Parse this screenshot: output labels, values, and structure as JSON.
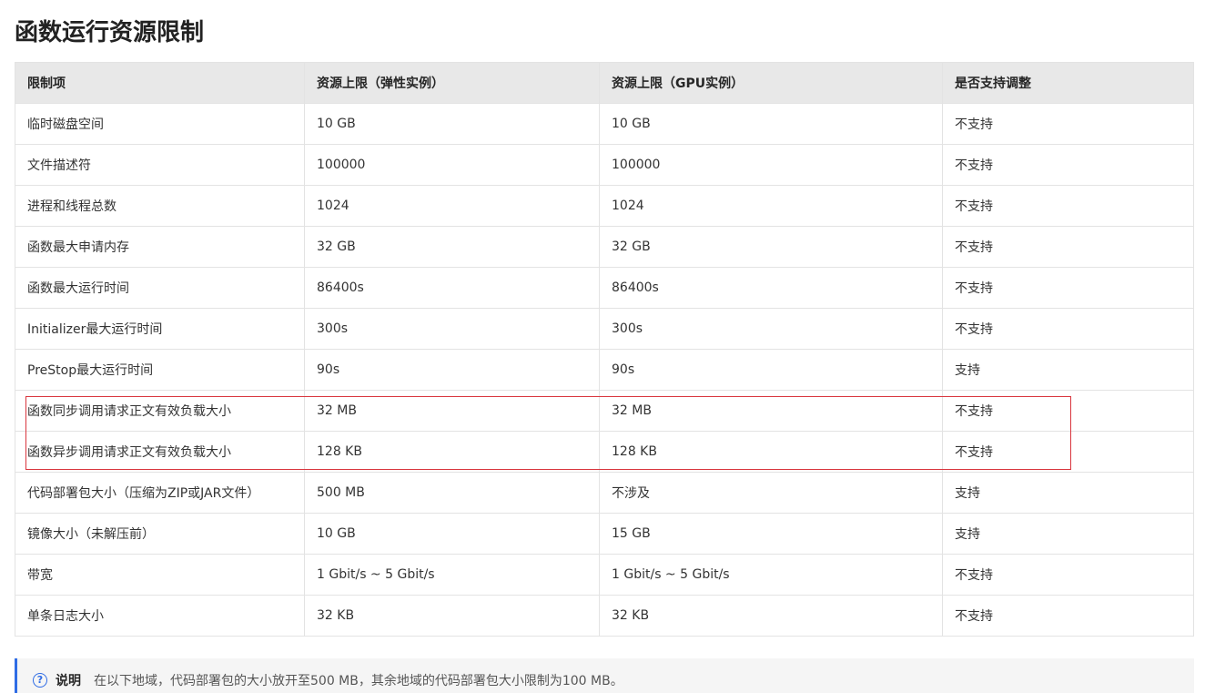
{
  "page_title": "函数运行资源限制",
  "table": {
    "headers": [
      "限制项",
      "资源上限（弹性实例）",
      "资源上限（GPU实例）",
      "是否支持调整"
    ],
    "rows": [
      [
        "临时磁盘空间",
        "10 GB",
        "10 GB",
        "不支持"
      ],
      [
        "文件描述符",
        "100000",
        "100000",
        "不支持"
      ],
      [
        "进程和线程总数",
        "1024",
        "1024",
        "不支持"
      ],
      [
        "函数最大申请内存",
        "32 GB",
        "32 GB",
        "不支持"
      ],
      [
        "函数最大运行时间",
        "86400s",
        "86400s",
        "不支持"
      ],
      [
        "Initializer最大运行时间",
        "300s",
        "300s",
        "不支持"
      ],
      [
        "PreStop最大运行时间",
        "90s",
        "90s",
        "支持"
      ],
      [
        "函数同步调用请求正文有效负载大小",
        "32 MB",
        "32 MB",
        "不支持"
      ],
      [
        "函数异步调用请求正文有效负载大小",
        "128 KB",
        "128 KB",
        "不支持"
      ],
      [
        "代码部署包大小（压缩为ZIP或JAR文件）",
        "500 MB",
        "不涉及",
        "支持"
      ],
      [
        "镜像大小（未解压前）",
        "10 GB",
        "15 GB",
        "支持"
      ],
      [
        "带宽",
        "1 Gbit/s ~ 5 Gbit/s",
        "1 Gbit/s ~ 5 Gbit/s",
        "不支持"
      ],
      [
        "单条日志大小",
        "32 KB",
        "32 KB",
        "不支持"
      ]
    ]
  },
  "note": {
    "icon": "question-circle-icon",
    "label": "说明",
    "text": "在以下地域，代码部署包的大小放开至500 MB，其余地域的代码部署包大小限制为100 MB。"
  },
  "colors": {
    "highlight_border": "#d9363e",
    "note_accent": "#2f6ce5",
    "header_bg": "#e8e8e8"
  }
}
